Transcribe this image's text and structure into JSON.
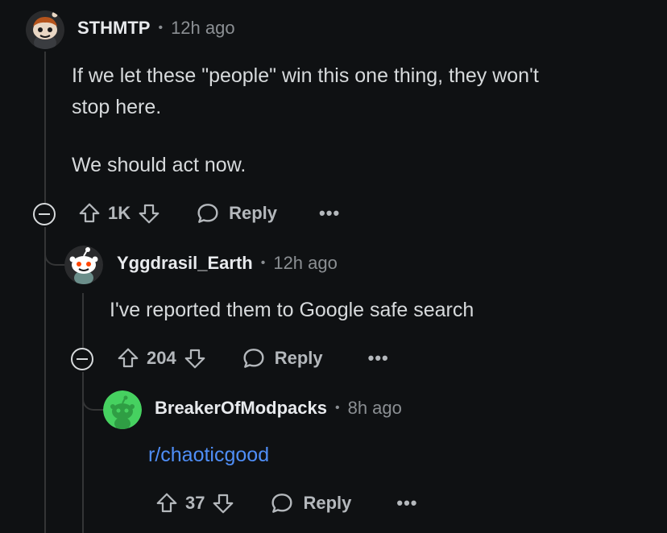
{
  "comments": [
    {
      "username": "STHMTP",
      "separator": "•",
      "time": "12h ago",
      "body_lines": [
        "If we let these \"people\" win this one thing, they won't",
        "stop here."
      ],
      "body_paragraph2": "We should act now.",
      "votes": "1K",
      "reply_label": "Reply",
      "more_label": "•••",
      "avatar_icon": "snoo-avatar-red-hair"
    },
    {
      "username": "Yggdrasil_Earth",
      "separator": "•",
      "time": "12h ago",
      "body": "I've reported them to Google safe search",
      "votes": "204",
      "reply_label": "Reply",
      "more_label": "•••",
      "avatar_icon": "snoo-avatar-default"
    },
    {
      "username": "BreakerOfModpacks",
      "separator": "•",
      "time": "8h ago",
      "body": "r/chaoticgood",
      "votes": "37",
      "reply_label": "Reply",
      "more_label": "•••",
      "avatar_icon": "snoo-avatar-green"
    }
  ],
  "colors": {
    "background": "#0f1113",
    "text": "#d7dadc",
    "muted": "#8b8f93",
    "link": "#4f8ef7",
    "thread": "#343536",
    "green_avatar": "#46d160"
  }
}
